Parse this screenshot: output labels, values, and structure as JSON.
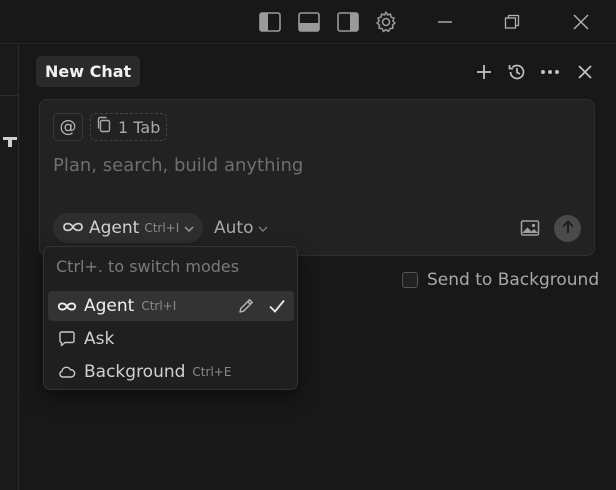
{
  "window": {
    "controls": [
      "toggle-primary-sidebar-icon",
      "toggle-panel-icon",
      "toggle-secondary-sidebar-icon",
      "settings-gear-icon",
      "minimize-icon",
      "restore-icon",
      "close-icon"
    ]
  },
  "chat": {
    "tab_title": "New Chat",
    "header_actions": [
      "new-chat-plus-icon",
      "history-icon",
      "more-icon",
      "close-chat-icon"
    ]
  },
  "composer": {
    "mention_symbol": "@",
    "context_chip": "1 Tab",
    "placeholder": "Plan, search, build anything",
    "mode_label": "Agent",
    "mode_shortcut": "Ctrl+I",
    "model_label": "Auto"
  },
  "send_to_background": {
    "label": "Send to Background",
    "checked": false
  },
  "mode_menu": {
    "hint": "Ctrl+. to switch modes",
    "items": [
      {
        "label": "Agent",
        "shortcut": "Ctrl+I",
        "icon": "infinity-icon",
        "selected": true
      },
      {
        "label": "Ask",
        "shortcut": "",
        "icon": "chat-bubble-icon",
        "selected": false
      },
      {
        "label": "Background",
        "shortcut": "Ctrl+E",
        "icon": "cloud-icon",
        "selected": false
      }
    ]
  },
  "colors": {
    "background": "#181818",
    "composer_bg": "#222222",
    "selected_item_bg": "#333333",
    "text_primary": "#f0f0f0",
    "text_muted": "#6e6e6e"
  }
}
